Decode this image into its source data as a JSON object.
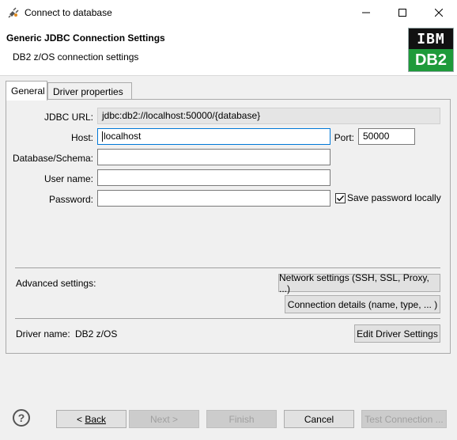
{
  "window": {
    "title": "Connect to database"
  },
  "header": {
    "title": "Generic JDBC Connection Settings",
    "subtitle": "DB2 z/OS connection settings",
    "logo_top": "IBM",
    "logo_bottom": "DB2"
  },
  "tabs": [
    {
      "label": "General",
      "active": true
    },
    {
      "label": "Driver properties",
      "active": false
    }
  ],
  "form": {
    "jdbc_url_label": "JDBC URL:",
    "jdbc_url_value": "jdbc:db2://localhost:50000/{database}",
    "host_label": "Host:",
    "host_value": "localhost",
    "port_label": "Port:",
    "port_value": "50000",
    "database_label": "Database/Schema:",
    "database_value": "",
    "username_label": "User name:",
    "username_value": "",
    "password_label": "Password:",
    "password_value": "",
    "save_password_label": "Save password locally",
    "save_password_checked": true
  },
  "advanced": {
    "label": "Advanced settings:",
    "network_button": "Network settings (SSH, SSL, Proxy, ...)",
    "connection_details_button": "Connection details (name, type, ... )"
  },
  "driver": {
    "label": "Driver name:",
    "value": "DB2 z/OS",
    "edit_button": "Edit Driver Settings"
  },
  "buttons": {
    "back": "Back",
    "next": "Next >",
    "finish": "Finish",
    "cancel": "Cancel",
    "test": "Test Connection ..."
  },
  "icons": {
    "app": "database-plug-icon",
    "minimize": "minimize-icon",
    "maximize": "maximize-icon",
    "close": "close-icon",
    "help": "help-icon"
  },
  "colors": {
    "accent": "#0078d7",
    "db2_green": "#1e9a3a"
  }
}
